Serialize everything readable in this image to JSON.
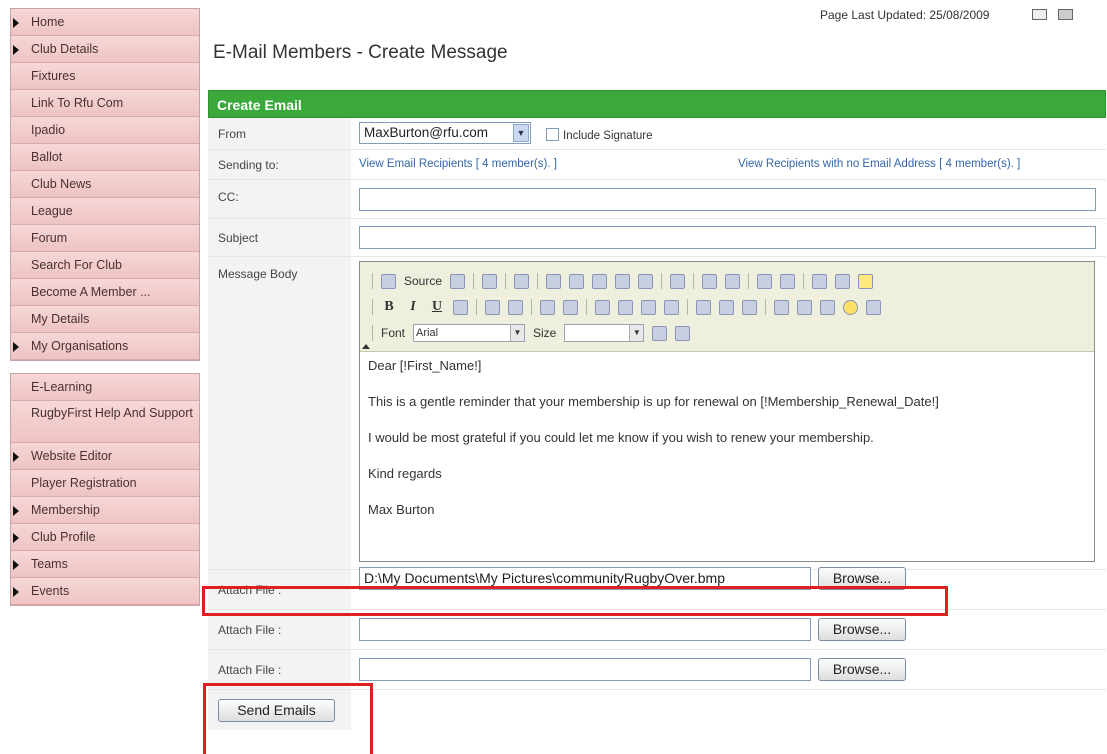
{
  "sidebar": {
    "group1": [
      {
        "label": "Home",
        "arrow": true
      },
      {
        "label": "Club Details",
        "arrow": true
      },
      {
        "label": "Fixtures",
        "arrow": false
      },
      {
        "label": "Link To Rfu Com",
        "arrow": false
      },
      {
        "label": "Ipadio",
        "arrow": false
      },
      {
        "label": "Ballot",
        "arrow": false
      },
      {
        "label": "Club News",
        "arrow": false
      },
      {
        "label": "League",
        "arrow": false
      },
      {
        "label": "Forum",
        "arrow": false
      },
      {
        "label": "Search For Club",
        "arrow": false
      },
      {
        "label": "Become A Member ...",
        "arrow": false
      },
      {
        "label": "My Details",
        "arrow": false
      },
      {
        "label": "My Organisations",
        "arrow": true
      }
    ],
    "group2": [
      {
        "label": "E-Learning",
        "arrow": false
      },
      {
        "label": "RugbyFirst Help And Support",
        "arrow": false
      },
      {
        "label": "Website Editor",
        "arrow": true
      },
      {
        "label": "Player Registration",
        "arrow": false
      },
      {
        "label": "Membership",
        "arrow": true
      },
      {
        "label": "Club Profile",
        "arrow": true
      },
      {
        "label": "Teams",
        "arrow": true
      },
      {
        "label": "Events",
        "arrow": true
      }
    ]
  },
  "header": {
    "updated": "Page Last Updated: 25/08/2009",
    "title": "E-Mail Members - Create Message",
    "icons": [
      "email-icon",
      "print-icon"
    ]
  },
  "form": {
    "heading": "Create Email",
    "from_label": "From",
    "from_value": "MaxBurton@rfu.com",
    "signature_label": "Include Signature",
    "sending_label": "Sending to:",
    "recipients_link": "View Email Recipients [ 4 member(s). ]",
    "no_email_link": "View Recipients with no Email Address [ 4 member(s). ]",
    "cc_label": "CC:",
    "cc_value": "",
    "subject_label": "Subject",
    "subject_value": "",
    "body_label": "Message Body",
    "toolbar": {
      "source_label": "Source",
      "font_label": "Font",
      "font_value": "Arial",
      "size_label": "Size",
      "size_value": ""
    },
    "body_lines": [
      "Dear [!First_Name!]",
      "This is a gentle reminder that your membership is up for renewal on [!Membership_Renewal_Date!]",
      "I would be most grateful if you could let me know if you wish to renew your membership.",
      "Kind regards",
      "Max Burton"
    ],
    "attachments": [
      {
        "label": "Attach File :",
        "value": "D:\\My Documents\\My Pictures\\communityRugbyOver.bmp",
        "button": "Browse..."
      },
      {
        "label": "Attach File :",
        "value": "",
        "button": "Browse..."
      },
      {
        "label": "Attach File :",
        "value": "",
        "button": "Browse..."
      }
    ],
    "send_label": "Send Emails"
  },
  "colors": {
    "header_green": "#3aa83a",
    "nav_pink": "#f2cccc",
    "highlight_red": "#e02020",
    "link_blue": "#3366aa"
  }
}
